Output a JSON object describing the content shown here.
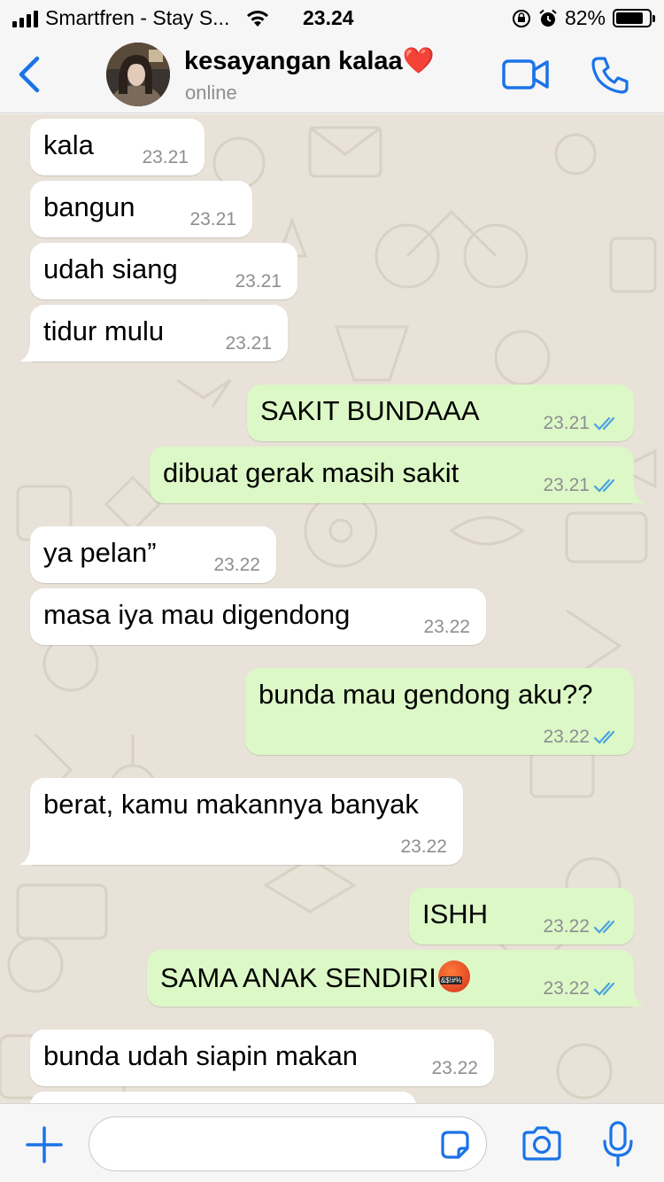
{
  "status_bar": {
    "carrier": "Smartfren - Stay S...",
    "time": "23.24",
    "battery": "82%",
    "battery_level": 0.82
  },
  "header": {
    "contact_name": "kesayangan kalaa",
    "contact_emoji": "❤️",
    "contact_status": "online",
    "icons": [
      "chevron-left-icon",
      "video-camera-icon",
      "phone-icon"
    ]
  },
  "messages": [
    {
      "dir": "in",
      "text": "kala",
      "time": "23.21"
    },
    {
      "dir": "in",
      "text": "bangun",
      "time": "23.21"
    },
    {
      "dir": "in",
      "text": "udah siang",
      "time": "23.21"
    },
    {
      "dir": "in",
      "text": "tidur mulu",
      "time": "23.21"
    },
    {
      "dir": "out",
      "text": "SAKIT BUNDAAA",
      "time": "23.21"
    },
    {
      "dir": "out",
      "text": "dibuat gerak masih sakit",
      "time": "23.21"
    },
    {
      "dir": "in",
      "text": "ya pelan”",
      "time": "23.22"
    },
    {
      "dir": "in",
      "text": "masa iya mau digendong",
      "time": "23.22"
    },
    {
      "dir": "out",
      "text": "bunda mau gendong aku??",
      "time": "23.22"
    },
    {
      "dir": "in",
      "text": "berat, kamu makannya banyak",
      "time": "23.22"
    },
    {
      "dir": "out",
      "text": "ISHH",
      "time": "23.22"
    },
    {
      "dir": "out",
      "text": "SAMA ANAK SENDIRI",
      "emoji": "face-with-symbols-on-mouth",
      "time": "23.22"
    },
    {
      "dir": "in",
      "text": "bunda udah siapin makan",
      "time": "23.22"
    }
  ],
  "input_bar": {
    "placeholder": "",
    "icons": [
      "plus-icon",
      "sticker-icon",
      "camera-icon",
      "microphone-icon"
    ]
  },
  "colors": {
    "accent": "#1a73e8",
    "bubble_in": "#ffffff",
    "bubble_out": "#dcf8c6",
    "read_ticks": "#4aa3df",
    "wallpaper": "#e8e2d8"
  }
}
